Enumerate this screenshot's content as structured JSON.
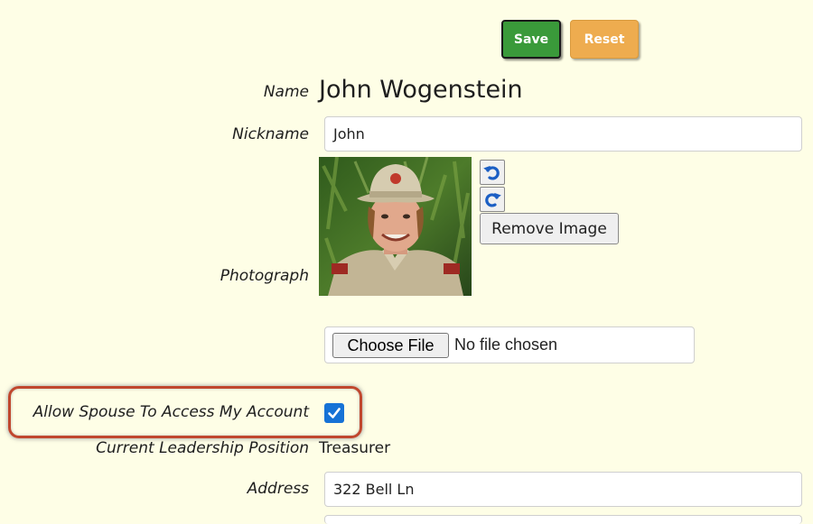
{
  "toolbar": {
    "save_label": "Save",
    "reset_label": "Reset"
  },
  "form": {
    "name": {
      "label": "Name",
      "value": "John Wogenstein"
    },
    "nickname": {
      "label": "Nickname",
      "value": "John"
    },
    "photograph": {
      "label": "Photograph",
      "rotate_left_icon": "rotate-counterclockwise-icon",
      "rotate_right_icon": "rotate-clockwise-icon",
      "remove_label": "Remove Image",
      "choose_file_label": "Choose File",
      "file_status": "No file chosen"
    },
    "spouse_access": {
      "label": "Allow Spouse To Access My Account",
      "checked": true
    },
    "leadership": {
      "label": "Current Leadership Position",
      "value": "Treasurer"
    },
    "address": {
      "label": "Address",
      "value": "322 Bell Ln"
    }
  },
  "colors": {
    "background": "#fefee6",
    "save": "#3a9a3a",
    "reset": "#eeac4f",
    "highlight": "#c0472e",
    "checkbox": "#1672d6"
  }
}
